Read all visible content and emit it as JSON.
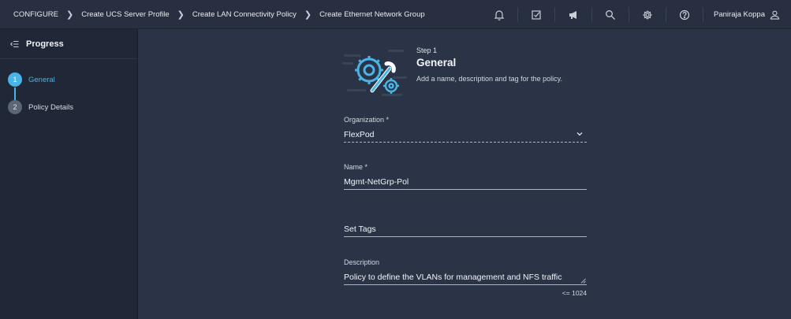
{
  "breadcrumb": [
    "CONFIGURE",
    "Create UCS Server Profile",
    "Create LAN Connectivity Policy",
    "Create Ethernet Network Group"
  ],
  "header_icons": [
    "bell-icon",
    "task-check-icon",
    "megaphone-icon",
    "search-icon",
    "gear-icon",
    "help-icon"
  ],
  "user": {
    "name": "Paniraja Koppa"
  },
  "sidebar": {
    "title": "Progress",
    "steps": [
      {
        "number": "1",
        "label": "General",
        "active": true
      },
      {
        "number": "2",
        "label": "Policy Details",
        "active": false
      }
    ]
  },
  "main": {
    "step_label": "Step 1",
    "title": "General",
    "subtitle": "Add a name, description and tag for the policy.",
    "organization": {
      "label": "Organization *",
      "value": "FlexPod"
    },
    "name": {
      "label": "Name *",
      "value": "Mgmt-NetGrp-Pol"
    },
    "tags": {
      "placeholder": "Set Tags"
    },
    "description": {
      "label": "Description",
      "value": "Policy to define the VLANs for management and NFS traffic",
      "limit": "<= 1024"
    }
  },
  "colors": {
    "accent": "#49b4e6",
    "background": "#2b3447",
    "sidebar": "#202736",
    "topbar": "#272f40"
  }
}
